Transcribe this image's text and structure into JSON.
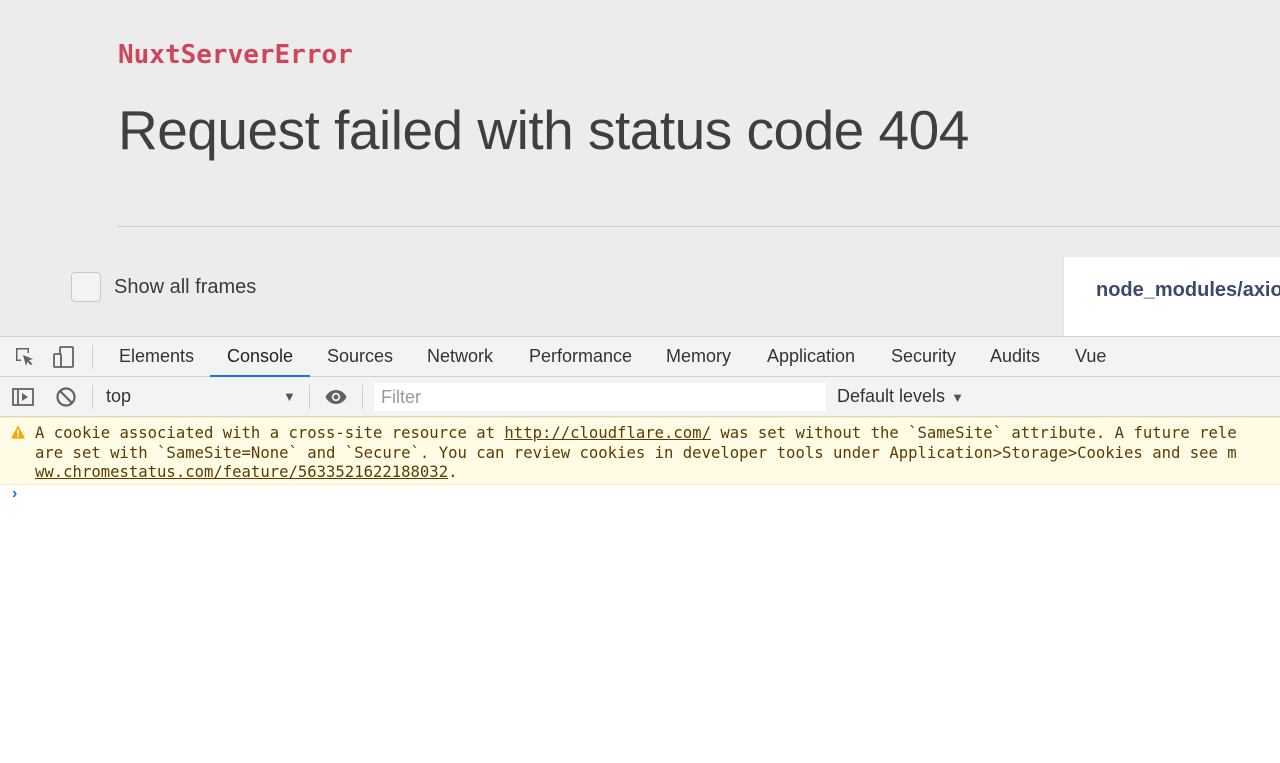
{
  "error_page": {
    "error_type": "NuxtServerError",
    "message": "Request failed with status code 404",
    "show_all_frames_label": "Show all frames",
    "frame_file": "node_modules/axios"
  },
  "devtools": {
    "tabs": [
      {
        "label": "Elements"
      },
      {
        "label": "Console",
        "active": true
      },
      {
        "label": "Sources"
      },
      {
        "label": "Network"
      },
      {
        "label": "Performance"
      },
      {
        "label": "Memory"
      },
      {
        "label": "Application"
      },
      {
        "label": "Security"
      },
      {
        "label": "Audits"
      },
      {
        "label": "Vue"
      }
    ],
    "toolbar": {
      "context": "top",
      "filter_placeholder": "Filter",
      "levels_label": "Default levels"
    },
    "warning": {
      "line1_prefix": "A cookie associated with a cross-site resource at ",
      "line1_link": "http://cloudflare.com/",
      "line1_suffix": " was set without the `SameSite` attribute. A future rele",
      "line2": "are set with `SameSite=None` and `Secure`. You can review cookies in developer tools under Application>Storage>Cookies and see m",
      "line3_link": "ww.chromestatus.com/feature/5633521622188032",
      "line3_suffix": "."
    },
    "prompt_symbol": "›"
  },
  "colors": {
    "error_type": "#d0455a",
    "accent": "#1a73e8",
    "warning_bg": "#fffbe5",
    "warning_text": "#5c3c00"
  },
  "icons": [
    "inspect-element-icon",
    "device-toolbar-icon",
    "sidebar-toggle-icon",
    "clear-console-icon",
    "eye-icon",
    "warning-icon"
  ]
}
